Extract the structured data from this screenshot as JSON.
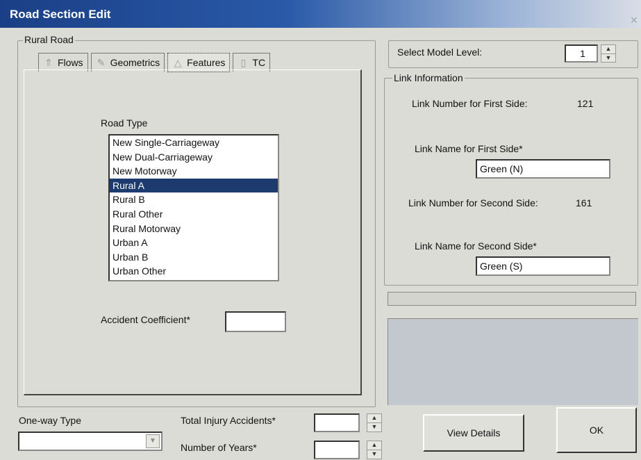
{
  "window": {
    "title": "Road Section Edit",
    "close_glyph": "×"
  },
  "rural_road": {
    "group_label": "Rural Road",
    "tabs": [
      {
        "label": "Flows",
        "icon": "flows-icon",
        "glyph": "⇑"
      },
      {
        "label": "Geometrics",
        "icon": "pencil-icon",
        "glyph": "✎"
      },
      {
        "label": "Features",
        "icon": "features-icon",
        "glyph": "△"
      },
      {
        "label": "TC",
        "icon": "tc-icon",
        "glyph": "▯"
      }
    ],
    "active_tab": "Features",
    "road_type_label": "Road Type",
    "road_types": [
      "New Single-Carriageway",
      "New Dual-Carriageway",
      "New Motorway",
      "Rural A",
      "Rural B",
      "Rural Other",
      "Rural Motorway",
      "Urban A",
      "Urban B",
      "Urban Other"
    ],
    "selected_road_type": "Rural A",
    "accident_coefficient_label": "Accident Coefficient*",
    "accident_coefficient_value": ""
  },
  "model_level": {
    "label": "Select Model Level:",
    "value": "1"
  },
  "link_info": {
    "group_label": "Link Information",
    "first_number_label": "Link Number for First Side:",
    "first_number_value": "121",
    "first_name_label": "Link Name for First Side*",
    "first_name_value": "Green (N)",
    "second_number_label": "Link Number for Second Side:",
    "second_number_value": "161",
    "second_name_label": "Link Name for Second Side*",
    "second_name_value": "Green (S)"
  },
  "bottom": {
    "oneway_label": "One-way Type",
    "oneway_value": "",
    "total_injury_label": "Total Injury Accidents*",
    "total_injury_value": "",
    "years_label": "Number of Years*",
    "years_value": ""
  },
  "buttons": {
    "view_details": "View Details",
    "ok": "OK"
  },
  "colors": {
    "title_bar": "#1a3f86",
    "selection": "#1c3a6e",
    "status_panel": "#c3c7ce"
  }
}
